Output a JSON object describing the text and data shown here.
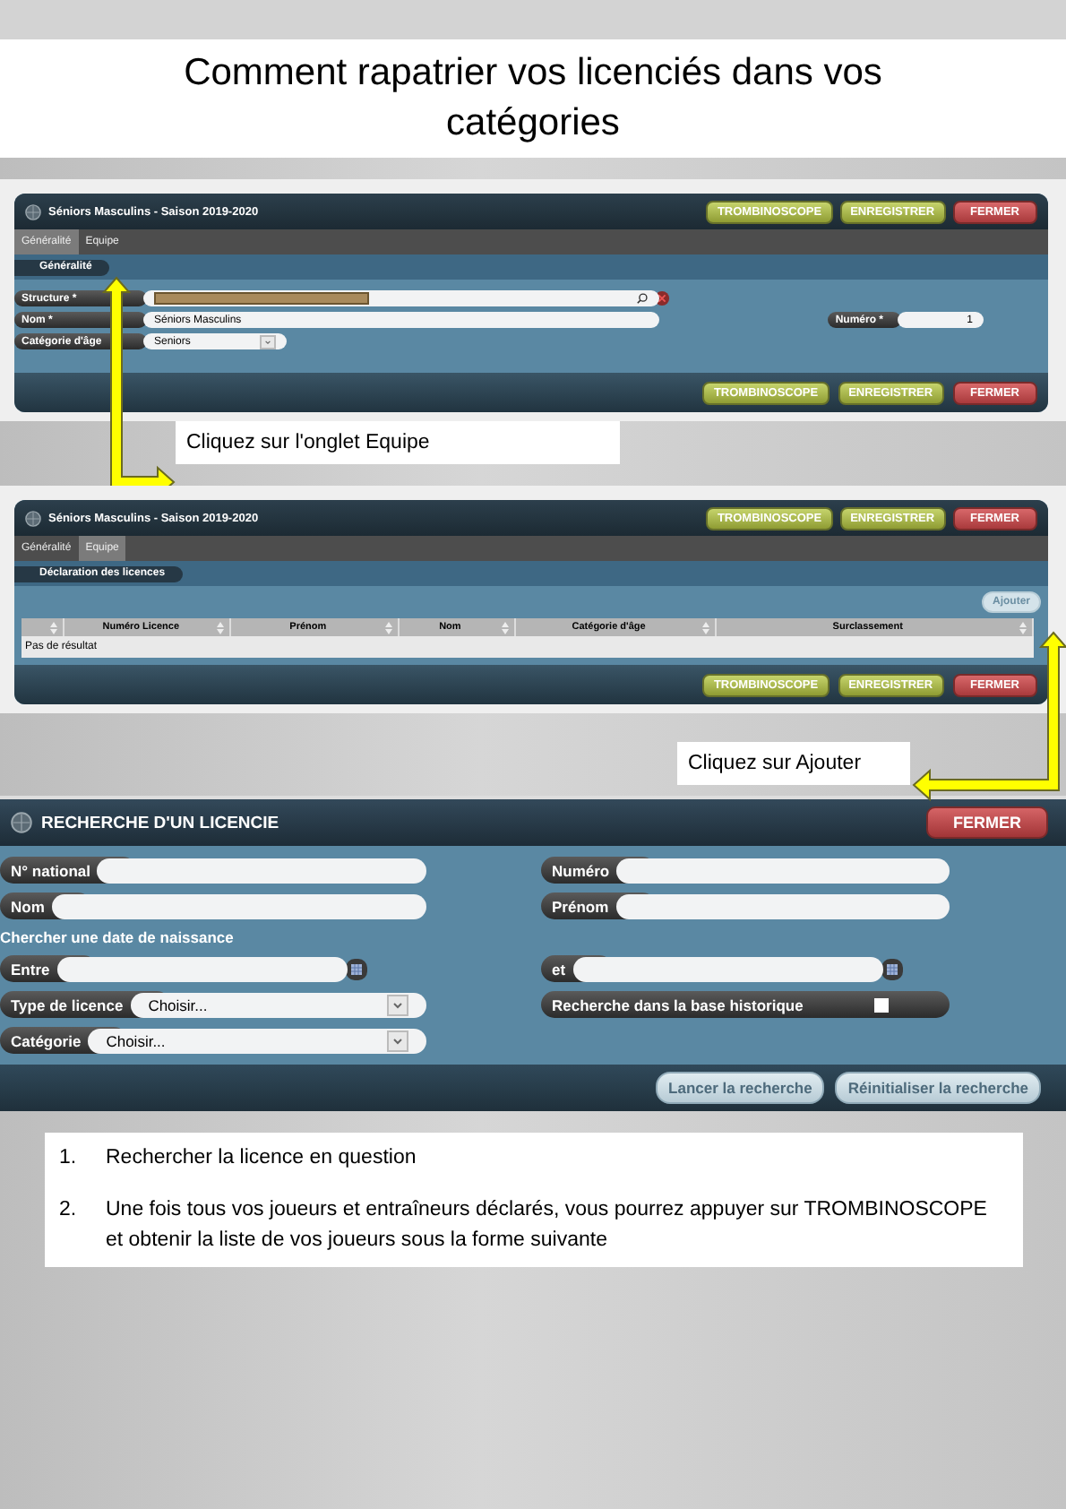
{
  "title": "Comment rapatrier vos licenciés dans vos catégories",
  "screen_1": {
    "window_title": "Séniors Masculins - Saison 2019-2020",
    "header_buttons": [
      {
        "label": "TROMBINOSCOPE",
        "kind": "green"
      },
      {
        "label": "ENREGISTRER",
        "kind": "green"
      },
      {
        "label": "FERMER",
        "kind": "red"
      }
    ],
    "tabs": [
      {
        "label": "Généralité",
        "selected": true
      },
      {
        "label": "Equipe",
        "selected": false
      }
    ],
    "section": "Généralité",
    "rows": [
      {
        "left": {
          "label": "Structure *",
          "kind": "search",
          "redacted": true
        }
      },
      {
        "left": {
          "label": "Nom *",
          "kind": "text",
          "value": "Séniors Masculins"
        },
        "right": {
          "label": "Numéro *",
          "kind": "number",
          "value": "1"
        }
      },
      {
        "left": {
          "label": "Catégorie d'âge",
          "kind": "select",
          "value": "Seniors"
        }
      }
    ],
    "footer_buttons": [
      {
        "label": "TROMBINOSCOPE",
        "kind": "green"
      },
      {
        "label": "ENREGISTRER",
        "kind": "green"
      },
      {
        "label": "FERMER",
        "kind": "red"
      }
    ]
  },
  "callout_1": "Cliquez sur l'onglet Equipe",
  "screen_2": {
    "window_title": "Séniors Masculins - Saison 2019-2020",
    "header_buttons": [
      {
        "label": "TROMBINOSCOPE",
        "kind": "green"
      },
      {
        "label": "ENREGISTRER",
        "kind": "green"
      },
      {
        "label": "FERMER",
        "kind": "red"
      }
    ],
    "tabs": [
      {
        "label": "Généralité",
        "selected": false
      },
      {
        "label": "Equipe",
        "selected": true
      }
    ],
    "section": "Déclaration des licences",
    "add_button": "Ajouter",
    "table": {
      "columns": [
        "Numéro Licence",
        "Prénom",
        "Nom",
        "Catégorie d'âge",
        "Surclassement"
      ],
      "empty_message": "Pas de résultat"
    },
    "footer_buttons": [
      {
        "label": "TROMBINOSCOPE",
        "kind": "green"
      },
      {
        "label": "ENREGISTRER",
        "kind": "green"
      },
      {
        "label": "FERMER",
        "kind": "red"
      }
    ]
  },
  "callout_2": "Cliquez sur Ajouter",
  "search_dialog": {
    "title": "RECHERCHE D'UN LICENCIE",
    "close_button": "FERMER",
    "rows": [
      {
        "kind": "fields",
        "left": {
          "label": "N° national",
          "kind": "text"
        },
        "right": {
          "label": "Numéro",
          "kind": "text"
        }
      },
      {
        "kind": "fields",
        "left": {
          "label": "Nom",
          "kind": "text"
        },
        "right": {
          "label": "Prénom",
          "kind": "text"
        }
      },
      {
        "kind": "heading",
        "text": "Chercher une date de naissance"
      },
      {
        "kind": "fields",
        "left": {
          "label": "Entre",
          "kind": "date"
        },
        "right": {
          "label": "et",
          "kind": "date"
        }
      },
      {
        "kind": "fields",
        "left": {
          "label": "Type de licence",
          "kind": "select",
          "value": "Choisir..."
        },
        "right": {
          "label": "Recherche dans la base historique",
          "kind": "checkbox",
          "checked": false
        }
      },
      {
        "kind": "fields",
        "left": {
          "label": "Catégorie",
          "kind": "select",
          "value": "Choisir..."
        }
      }
    ],
    "footer_buttons": [
      "Lancer la recherche",
      "Réinitialiser la recherche"
    ]
  },
  "instructions": [
    {
      "number": "1.",
      "text": "Rechercher la licence en question"
    },
    {
      "number": "2.",
      "text": "Une fois tous vos joueurs et entraîneurs déclarés, vous pourrez appuyer sur  TROMBINOSCOPE et obtenir la liste de vos joueurs sous la forme suivante"
    }
  ]
}
